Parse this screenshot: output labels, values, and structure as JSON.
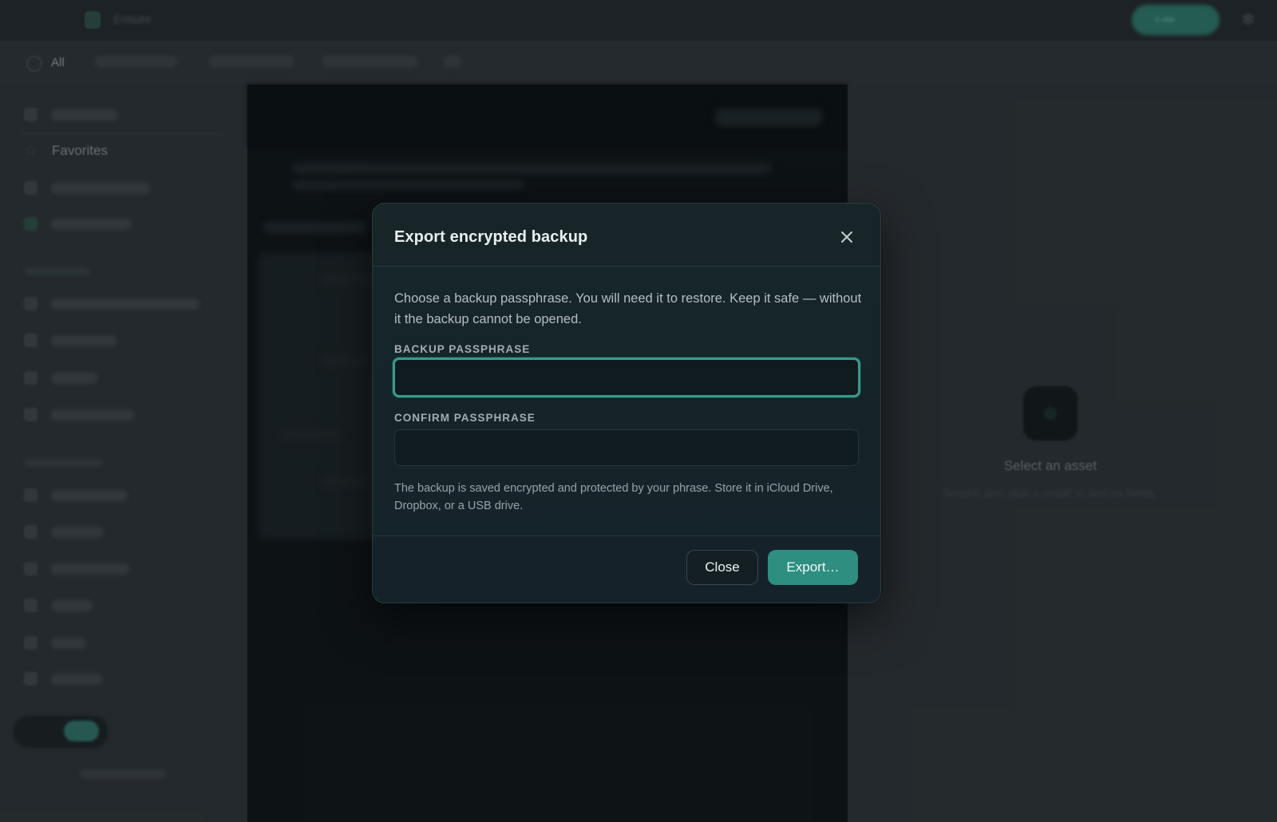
{
  "topbar": {
    "brand": "Ensure"
  },
  "filterbar": {
    "all_label": "All"
  },
  "sidebar": {
    "favorites_label": "Favorites"
  },
  "detail": {
    "empty_title": "Select an asset",
    "empty_subtitle": "Search and pick a result to see its fields."
  },
  "modal": {
    "title": "Export encrypted backup",
    "description": "Choose a backup passphrase. You will need it to restore. Keep it safe — without it the backup cannot be opened.",
    "passphrase_label": "BACKUP PASSPHRASE",
    "passphrase_value": "",
    "confirm_label": "CONFIRM PASSPHRASE",
    "confirm_value": "",
    "hint": "The backup is saved encrypted and protected by your phrase. Store it in iCloud Drive, Dropbox, or a USB drive.",
    "close_label": "Close",
    "export_label": "Export…"
  },
  "colors": {
    "accent": "#2e8e80",
    "focus_ring": "#3a9a8b",
    "modal_bg": "#17262a"
  }
}
